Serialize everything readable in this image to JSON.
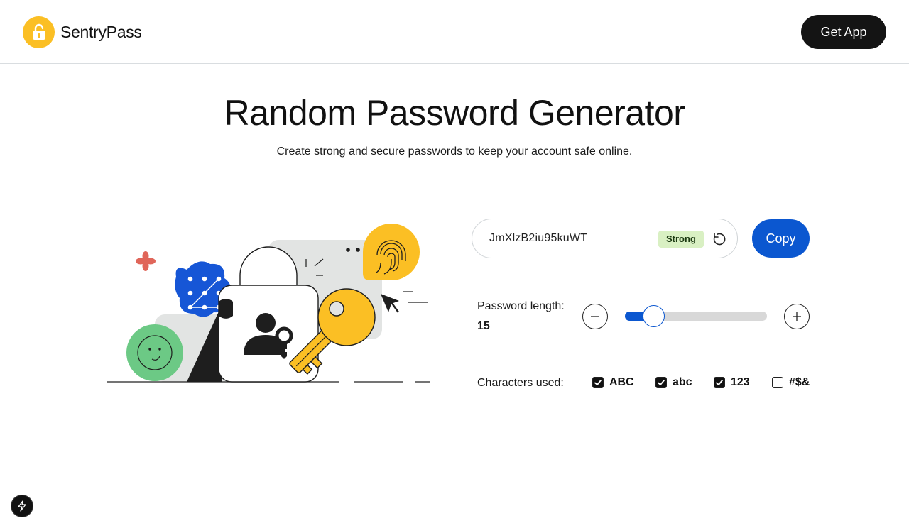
{
  "header": {
    "brand_name": "SentryPass",
    "get_app_label": "Get App"
  },
  "hero": {
    "title": "Random Password Generator",
    "subtitle": "Create strong and secure passwords to keep your account safe online."
  },
  "generator": {
    "password": "JmXlzB2iu95kuWT",
    "strength": "Strong",
    "copy_label": "Copy",
    "length_label": "Password length:",
    "length_value": "15",
    "length_fraction": 0.2,
    "characters_label": "Characters used:",
    "options": [
      {
        "label": "ABC",
        "checked": true
      },
      {
        "label": "abc",
        "checked": true
      },
      {
        "label": "123",
        "checked": true
      },
      {
        "label": "#$&",
        "checked": false
      }
    ]
  },
  "colors": {
    "brand_yellow": "#fbbf24",
    "accent_blue": "#0b57d0",
    "strength_bg": "#d9f0c3"
  },
  "icons": [
    "lock-icon",
    "refresh-icon",
    "minus-icon",
    "plus-icon",
    "check-icon",
    "bolt-icon"
  ]
}
